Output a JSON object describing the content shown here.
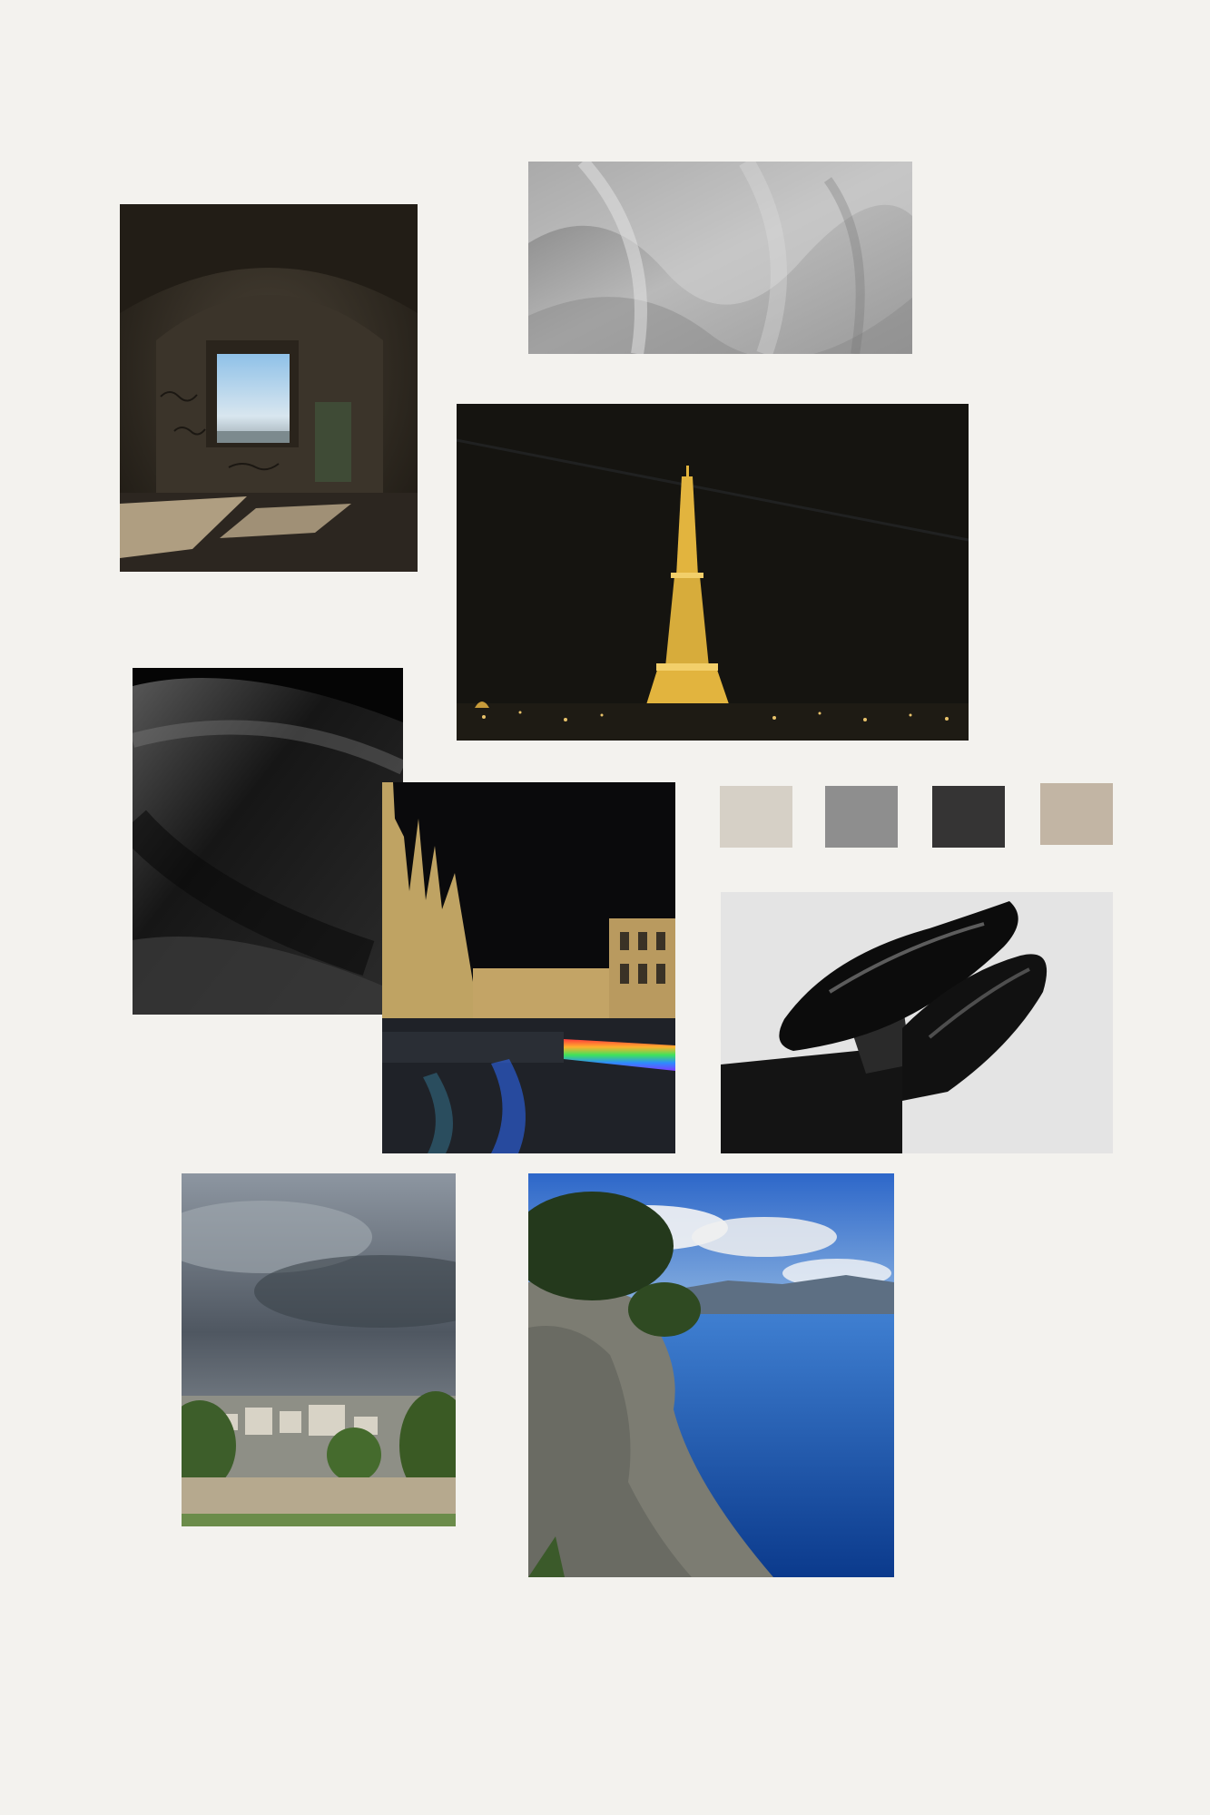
{
  "moodboard": {
    "background": "#f3f2ee",
    "photos": [
      {
        "id": "arch",
        "icon": "stone-archway-window-photo"
      },
      {
        "id": "silk",
        "icon": "grey-silk-fabric-photo"
      },
      {
        "id": "eiffel",
        "icon": "eiffel-tower-night-photo"
      },
      {
        "id": "fabric",
        "icon": "black-fabric-folds-photo"
      },
      {
        "id": "duomo",
        "icon": "milan-duomo-night-photo"
      },
      {
        "id": "loafers",
        "icon": "black-loafers-photo"
      },
      {
        "id": "montmartre",
        "icon": "paris-view-cloudy-sky-photo"
      },
      {
        "id": "coast",
        "icon": "cliff-and-sea-coast-photo"
      }
    ],
    "palette": [
      "#d6d0c6",
      "#8e8e8e",
      "#353434",
      "#c2b5a4"
    ]
  }
}
